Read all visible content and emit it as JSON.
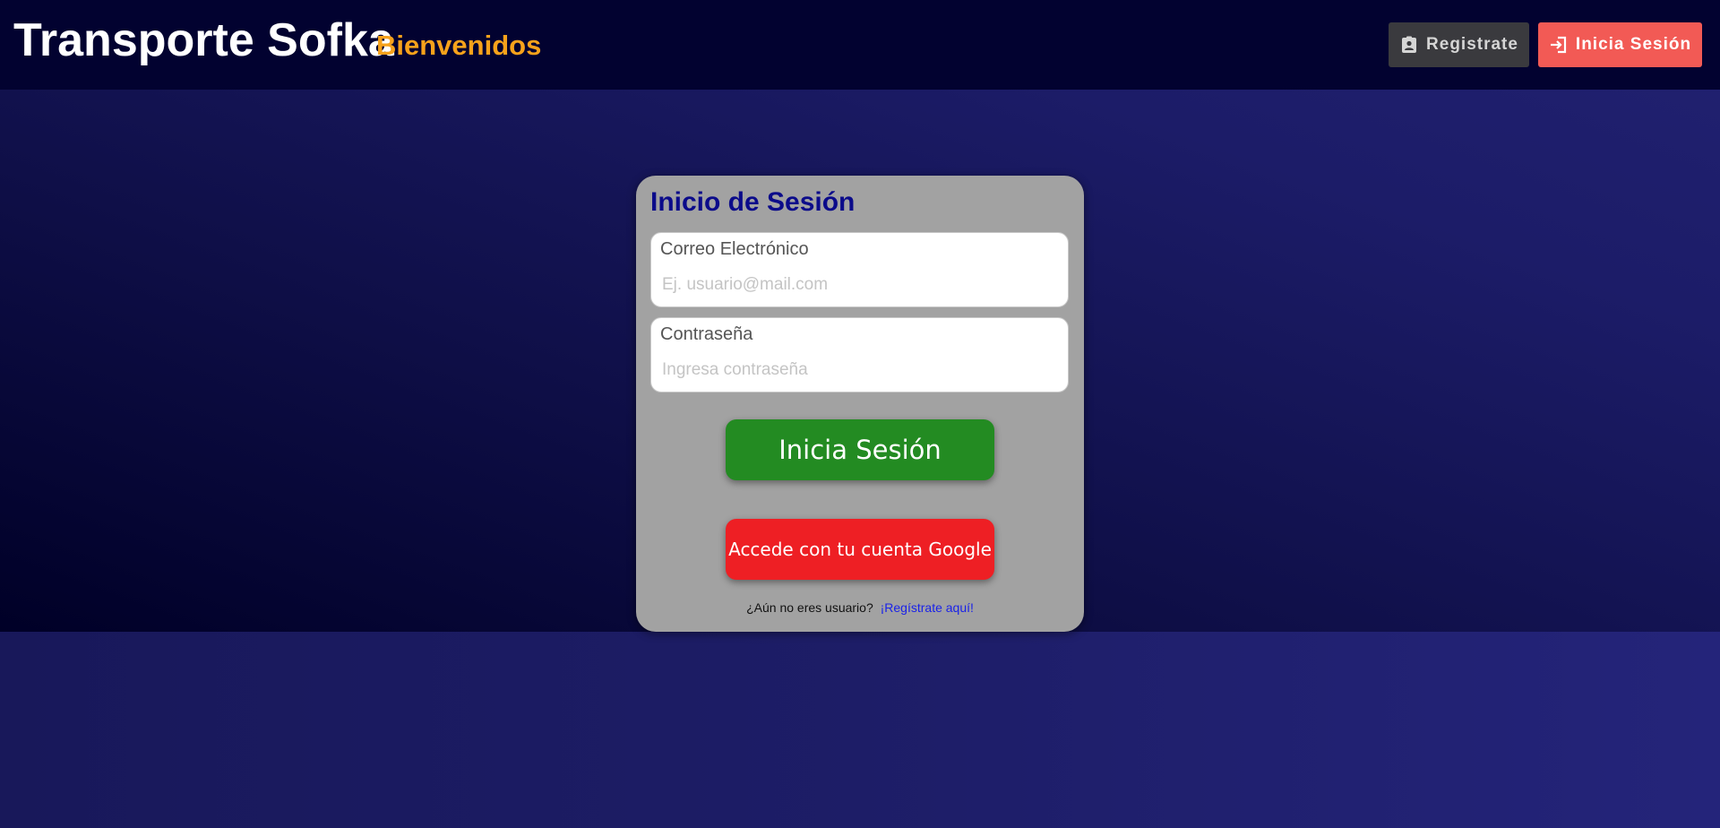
{
  "header": {
    "brand": "Transporte Sofka",
    "welcome": "Bienvenidos",
    "register_label": "Registrate",
    "login_label": "Inicia Sesión"
  },
  "login_card": {
    "title": "Inicio de Sesión",
    "email": {
      "label": "Correo Electrónico",
      "value": "",
      "placeholder": "Ej. usuario@mail.com"
    },
    "password": {
      "label": "Contraseña",
      "value": "",
      "placeholder": "Ingresa contraseña"
    },
    "submit_label": "Inicia Sesión",
    "google_label": "Accede con tu cuenta Google",
    "no_account_text": "¿Aún no eres usuario?",
    "register_link": "¡Regístrate aquí!"
  },
  "colors": {
    "topbar": "#020230",
    "brand_text": "#ffffff",
    "welcome_text": "#f7a21b",
    "register_button": "#3a3a3e",
    "login_button": "#f25a55",
    "card_background": "#a2a2a2",
    "card_title": "#0b0b8a",
    "submit_button": "#238b22",
    "google_button": "#ee1f24",
    "link": "#1a22e8"
  },
  "icons": {
    "register": "contact-badge-icon",
    "login": "login-arrow-icon"
  }
}
